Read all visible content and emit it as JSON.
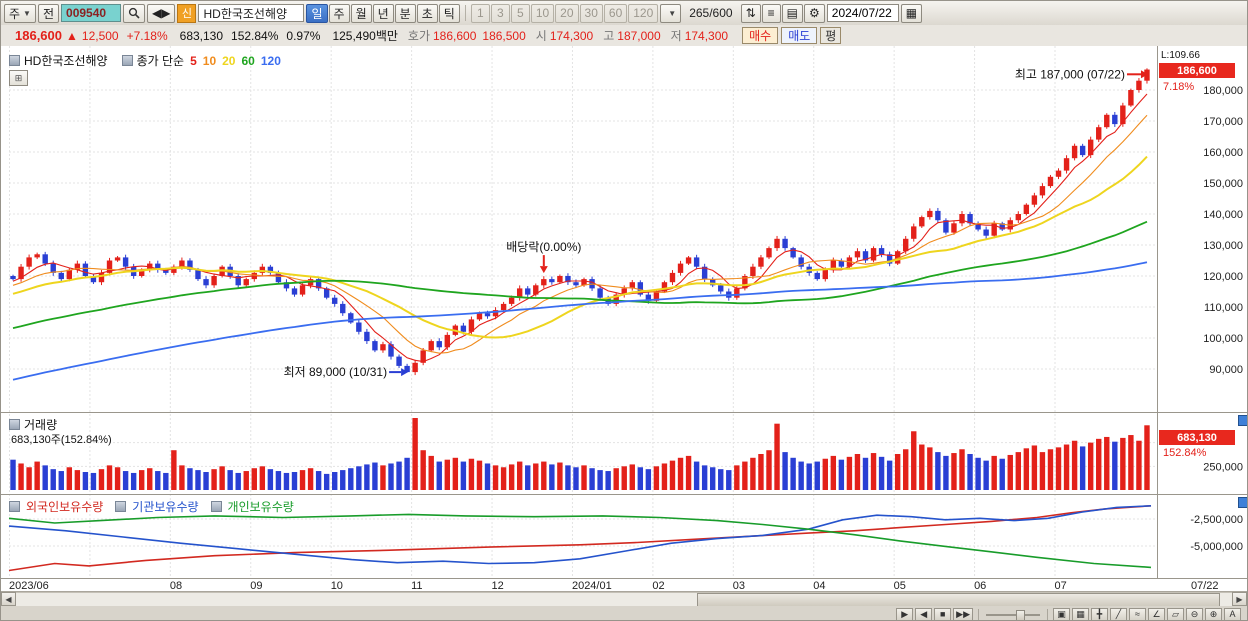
{
  "colors": {
    "up": "#e3211a",
    "down": "#2a3fd4",
    "grid": "#e3e3e3",
    "separator": "#9a968c",
    "badge_bg": "#e8281e",
    "code_field_bg": "#79d2cf",
    "active_period_bg": "#3a6fc4"
  },
  "toolbar": {
    "menu_combo": "주",
    "all_button": "전",
    "code": "009540",
    "new_badge": "신",
    "stock_name": "HD한국조선해양",
    "periods": [
      {
        "label": "일",
        "active": true
      },
      {
        "label": "주"
      },
      {
        "label": "월"
      },
      {
        "label": "년"
      },
      {
        "label": "분"
      },
      {
        "label": "초"
      },
      {
        "label": "틱"
      }
    ],
    "intervals": [
      "1",
      "3",
      "5",
      "10",
      "20",
      "30",
      "60",
      "120"
    ],
    "bar_count": "265/600",
    "icon_buttons": [
      {
        "name": "compare-icon",
        "glyph": "⇅"
      },
      {
        "name": "edit-list-icon",
        "glyph": "≡"
      },
      {
        "name": "print-icon",
        "glyph": "▤"
      },
      {
        "name": "gear-icon",
        "glyph": "⚙"
      }
    ],
    "date": "2024/07/22",
    "calendar_glyph": "▦"
  },
  "quote": {
    "price": "186,600",
    "arrow": "▲",
    "change": "12,500",
    "pct": "+7.18%",
    "volume": "683,130",
    "vol_ratio": "152.84%",
    "turnover": "0.97%",
    "amount": "125,490백만",
    "hoga_label": "호가",
    "ask": "186,600",
    "bid": "186,500",
    "open_label": "시",
    "open": "174,300",
    "high_label": "고",
    "high": "187,000",
    "low_label": "저",
    "low": "174,300",
    "buy": "매수",
    "sell": "매도",
    "avg": "평"
  },
  "scrollbar": {
    "left": "◀",
    "right": "▶"
  },
  "bottom_toolbar": {
    "playback_icons": [
      {
        "name": "play-button",
        "glyph": "▶"
      },
      {
        "name": "step-back-button",
        "glyph": "◀"
      },
      {
        "name": "stop-button",
        "glyph": "■"
      },
      {
        "name": "fast-forward-button",
        "glyph": "▶▶"
      }
    ],
    "tool_icons": [
      {
        "name": "new-window-icon",
        "glyph": "▣"
      },
      {
        "name": "dual-window-icon",
        "glyph": "▦"
      },
      {
        "name": "crosshair-tool-icon",
        "glyph": "╋"
      },
      {
        "name": "trendline-tool-icon",
        "glyph": "╱"
      },
      {
        "name": "wave-tool-icon",
        "glyph": "≈"
      },
      {
        "name": "angle-tool-icon",
        "glyph": "∠"
      },
      {
        "name": "shape-tool-icon",
        "glyph": "▱"
      },
      {
        "name": "zoom-out-button",
        "glyph": "⊖"
      },
      {
        "name": "zoom-in-button",
        "glyph": "⊕"
      },
      {
        "name": "text-tool-button",
        "glyph": "A"
      }
    ]
  },
  "chart_data": {
    "type": "candlestick",
    "title": "HD한국조선해양",
    "legend_prefix": "종가 단순",
    "unit_note": "prices in thousands of KRW",
    "right_info": {
      "l": "L:109.66",
      "price": "186,600",
      "pct": "7.18%"
    },
    "price_ticks_k": [
      180,
      170,
      160,
      150,
      140,
      130,
      120,
      110,
      100,
      90
    ],
    "ylim_k": [
      85,
      192
    ],
    "ma_seed_start_k": 53,
    "ma": [
      {
        "period": 5,
        "color": "#e3211a",
        "width": 1.1
      },
      {
        "period": 10,
        "color": "#f08c1e",
        "width": 1.1
      },
      {
        "period": 20,
        "color": "#eed51e",
        "width": 2.0
      },
      {
        "period": 60,
        "color": "#1fa51f",
        "width": 1.8
      },
      {
        "period": 120,
        "color": "#3a6df0",
        "width": 1.8
      }
    ],
    "closes_k": [
      119,
      123,
      126,
      127,
      124,
      121,
      119,
      122,
      124,
      120,
      118,
      121,
      125,
      126,
      123,
      120,
      122,
      124,
      122,
      121,
      123,
      125,
      122,
      119,
      117,
      120,
      123,
      120,
      117,
      119,
      121,
      123,
      121,
      118,
      116,
      114,
      117,
      119,
      116,
      113,
      111,
      108,
      105,
      102,
      99,
      96,
      98,
      94,
      91,
      89,
      92,
      96,
      99,
      97,
      101,
      104,
      102,
      106,
      108,
      107,
      109,
      111,
      113,
      116,
      114,
      117,
      119,
      118,
      120,
      118,
      117,
      119,
      116,
      113,
      111,
      114,
      116,
      118,
      114,
      112,
      115,
      118,
      121,
      124,
      126,
      123,
      119,
      117,
      115,
      113,
      116,
      120,
      123,
      126,
      129,
      132,
      129,
      126,
      123,
      121,
      119,
      122,
      125,
      123,
      126,
      128,
      125,
      129,
      127,
      124,
      128,
      132,
      136,
      139,
      141,
      138,
      134,
      137,
      140,
      137,
      135,
      133,
      137,
      135,
      138,
      140,
      143,
      146,
      149,
      152,
      154,
      158,
      162,
      159,
      164,
      168,
      172,
      169,
      175,
      180,
      183,
      186.6
    ],
    "volumes_k": [
      320,
      280,
      240,
      300,
      260,
      220,
      200,
      240,
      210,
      190,
      180,
      220,
      260,
      240,
      200,
      180,
      210,
      230,
      200,
      180,
      420,
      260,
      230,
      210,
      190,
      220,
      250,
      210,
      180,
      200,
      230,
      250,
      220,
      200,
      180,
      190,
      210,
      230,
      200,
      170,
      190,
      210,
      230,
      250,
      270,
      290,
      260,
      280,
      300,
      340,
      760,
      420,
      360,
      300,
      320,
      340,
      300,
      330,
      310,
      280,
      260,
      240,
      270,
      300,
      260,
      280,
      300,
      270,
      290,
      260,
      240,
      260,
      230,
      210,
      200,
      230,
      250,
      270,
      240,
      220,
      250,
      280,
      310,
      340,
      360,
      300,
      260,
      240,
      220,
      210,
      260,
      300,
      340,
      380,
      420,
      700,
      400,
      340,
      300,
      280,
      300,
      330,
      360,
      320,
      350,
      380,
      340,
      390,
      350,
      310,
      380,
      430,
      620,
      480,
      450,
      400,
      360,
      390,
      430,
      380,
      340,
      310,
      360,
      330,
      370,
      400,
      440,
      470,
      400,
      430,
      450,
      480,
      520,
      460,
      500,
      540,
      560,
      510,
      550,
      580,
      520,
      683
    ],
    "months": [
      {
        "label": "2023/06",
        "index": 0
      },
      {
        "label": "",
        "index": 10
      },
      {
        "label": "08",
        "index": 20
      },
      {
        "label": "09",
        "index": 30
      },
      {
        "label": "10",
        "index": 40
      },
      {
        "label": "11",
        "index": 50
      },
      {
        "label": "12",
        "index": 60
      },
      {
        "label": "2024/01",
        "index": 70
      },
      {
        "label": "02",
        "index": 80
      },
      {
        "label": "03",
        "index": 90
      },
      {
        "label": "04",
        "index": 100
      },
      {
        "label": "05",
        "index": 110
      },
      {
        "label": "06",
        "index": 120
      },
      {
        "label": "07",
        "index": 130
      },
      {
        "label": "07/22",
        "right_axis": true
      }
    ],
    "annotations": {
      "low": {
        "text": "최저 89,000 (10/31)",
        "price_k": 89
      },
      "high": {
        "text": "최고 187,000 (07/22)",
        "price_k": 187
      },
      "dividend": {
        "text": "배당락(0.00%)",
        "index": 66
      }
    },
    "volume": {
      "title": "거래량",
      "summary": "683,130주(152.84%)",
      "badge": "683,130",
      "badge_pct": "152.84%",
      "scale_max_k": 760,
      "grid_k": [
        250,
        500
      ],
      "tick_labels": [
        {
          "value_k": 250,
          "label": "250,000"
        }
      ]
    },
    "holders": {
      "axis": [
        {
          "text": "-2,500,000",
          "frac": 0.27
        },
        {
          "text": "-5,000,000",
          "frac": 0.615
        }
      ],
      "series": [
        {
          "name": "외국인보유수량",
          "color": "#d22920",
          "points": [
            [
              0,
              0.93
            ],
            [
              0.04,
              0.84
            ],
            [
              0.07,
              0.87
            ],
            [
              0.12,
              0.8
            ],
            [
              0.18,
              0.74
            ],
            [
              0.25,
              0.7
            ],
            [
              0.33,
              0.67
            ],
            [
              0.42,
              0.63
            ],
            [
              0.5,
              0.6
            ],
            [
              0.55,
              0.57
            ],
            [
              0.6,
              0.53
            ],
            [
              0.65,
              0.49
            ],
            [
              0.7,
              0.45
            ],
            [
              0.74,
              0.42
            ],
            [
              0.78,
              0.38
            ],
            [
              0.82,
              0.34
            ],
            [
              0.86,
              0.3
            ],
            [
              0.9,
              0.25
            ],
            [
              0.93,
              0.19
            ],
            [
              0.96,
              0.14
            ],
            [
              1,
              0.1
            ]
          ]
        },
        {
          "name": "기관보유수량",
          "color": "#2553cc",
          "points": [
            [
              0,
              0.36
            ],
            [
              0.05,
              0.42
            ],
            [
              0.1,
              0.5
            ],
            [
              0.15,
              0.58
            ],
            [
              0.2,
              0.65
            ],
            [
              0.25,
              0.72
            ],
            [
              0.3,
              0.79
            ],
            [
              0.34,
              0.83
            ],
            [
              0.38,
              0.81
            ],
            [
              0.42,
              0.84
            ],
            [
              0.46,
              0.83
            ],
            [
              0.5,
              0.78
            ],
            [
              0.54,
              0.68
            ],
            [
              0.58,
              0.58
            ],
            [
              0.62,
              0.52
            ],
            [
              0.66,
              0.48
            ],
            [
              0.7,
              0.4
            ],
            [
              0.73,
              0.28
            ],
            [
              0.76,
              0.22
            ],
            [
              0.79,
              0.24
            ],
            [
              0.82,
              0.28
            ],
            [
              0.85,
              0.26
            ],
            [
              0.88,
              0.29
            ],
            [
              0.91,
              0.26
            ],
            [
              0.94,
              0.18
            ],
            [
              0.97,
              0.12
            ],
            [
              1,
              0.1
            ]
          ]
        },
        {
          "name": "개인보유수량",
          "color": "#189c2a",
          "points": [
            [
              0,
              0.26
            ],
            [
              0.04,
              0.32
            ],
            [
              0.08,
              0.29
            ],
            [
              0.13,
              0.25
            ],
            [
              0.18,
              0.23
            ],
            [
              0.24,
              0.25
            ],
            [
              0.3,
              0.23
            ],
            [
              0.35,
              0.21
            ],
            [
              0.4,
              0.23
            ],
            [
              0.46,
              0.24
            ],
            [
              0.52,
              0.23
            ],
            [
              0.57,
              0.25
            ],
            [
              0.62,
              0.29
            ],
            [
              0.66,
              0.34
            ],
            [
              0.7,
              0.4
            ],
            [
              0.74,
              0.47
            ],
            [
              0.78,
              0.55
            ],
            [
              0.82,
              0.62
            ],
            [
              0.86,
              0.69
            ],
            [
              0.9,
              0.76
            ],
            [
              0.95,
              0.84
            ],
            [
              1,
              0.89
            ]
          ]
        }
      ]
    }
  }
}
